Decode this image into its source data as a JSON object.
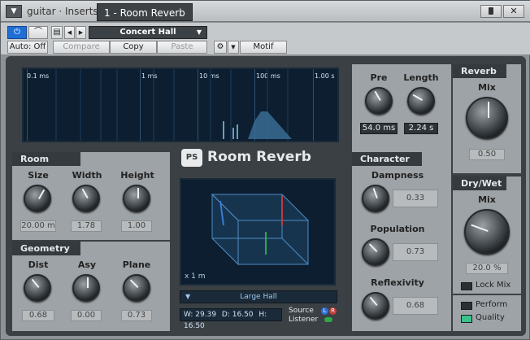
{
  "titlebar": {
    "menu_glyph": "▼",
    "window_title": "guitar · Inserts",
    "tab_label": "1 - Room Reverb",
    "pin_glyph": "📌",
    "close_glyph": "✕"
  },
  "toolbar": {
    "power_glyph": "⏻",
    "bypass_glyph": "⌒",
    "list_glyph": "▤",
    "prev_glyph": "◀",
    "next_glyph": "▶",
    "preset_name": "Concert Hall",
    "preset_arrow": "▼",
    "auto_label": "Auto: Off",
    "compare_label": "Compare",
    "copy_label": "Copy",
    "paste_label": "Paste",
    "gear_glyph": "⚙",
    "gear_arrow": "▼",
    "motif_label": "Motif"
  },
  "display": {
    "ticks": [
      "0.1 ms",
      "1 ms",
      "10 ms",
      "100 ms",
      "1.00 s"
    ]
  },
  "brand": {
    "logo_text": "PS",
    "title": "Room Reverb"
  },
  "room": {
    "section": "Room",
    "size": {
      "label": "Size",
      "value": "20.00 m"
    },
    "width": {
      "label": "Width",
      "value": "1.78"
    },
    "height": {
      "label": "Height",
      "value": "1.00"
    }
  },
  "geometry": {
    "section": "Geometry",
    "dist": {
      "label": "Dist",
      "value": "0.68"
    },
    "asy": {
      "label": "Asy",
      "value": "0.00"
    },
    "plane": {
      "label": "Plane",
      "value": "0.73"
    }
  },
  "view3d": {
    "scale_label": "x 1 m",
    "room_type": "Large Hall",
    "w_label": "W:",
    "w_value": "29.39",
    "d_label": "D:",
    "d_value": "16.50",
    "h_label": "H:",
    "h_value": "16.50",
    "source_label": "Source",
    "listener_label": "Listener",
    "l_badge": "L",
    "r_badge": "R"
  },
  "timing": {
    "pre": {
      "label": "Pre",
      "value": "54.0 ms"
    },
    "length": {
      "label": "Length",
      "value": "2.24 s"
    }
  },
  "character": {
    "section": "Character",
    "dampness": {
      "label": "Dampness",
      "value": "0.33"
    },
    "population": {
      "label": "Population",
      "value": "0.73"
    },
    "reflexivity": {
      "label": "Reflexivity",
      "value": "0.68"
    }
  },
  "reverb": {
    "section": "Reverb",
    "mix": {
      "label": "Mix",
      "value": "0.50"
    }
  },
  "drywet": {
    "section": "Dry/Wet",
    "mix": {
      "label": "Mix",
      "value": "20.0 %"
    },
    "lock_mix": "Lock Mix",
    "perform": "Perform",
    "quality": "Quality"
  }
}
